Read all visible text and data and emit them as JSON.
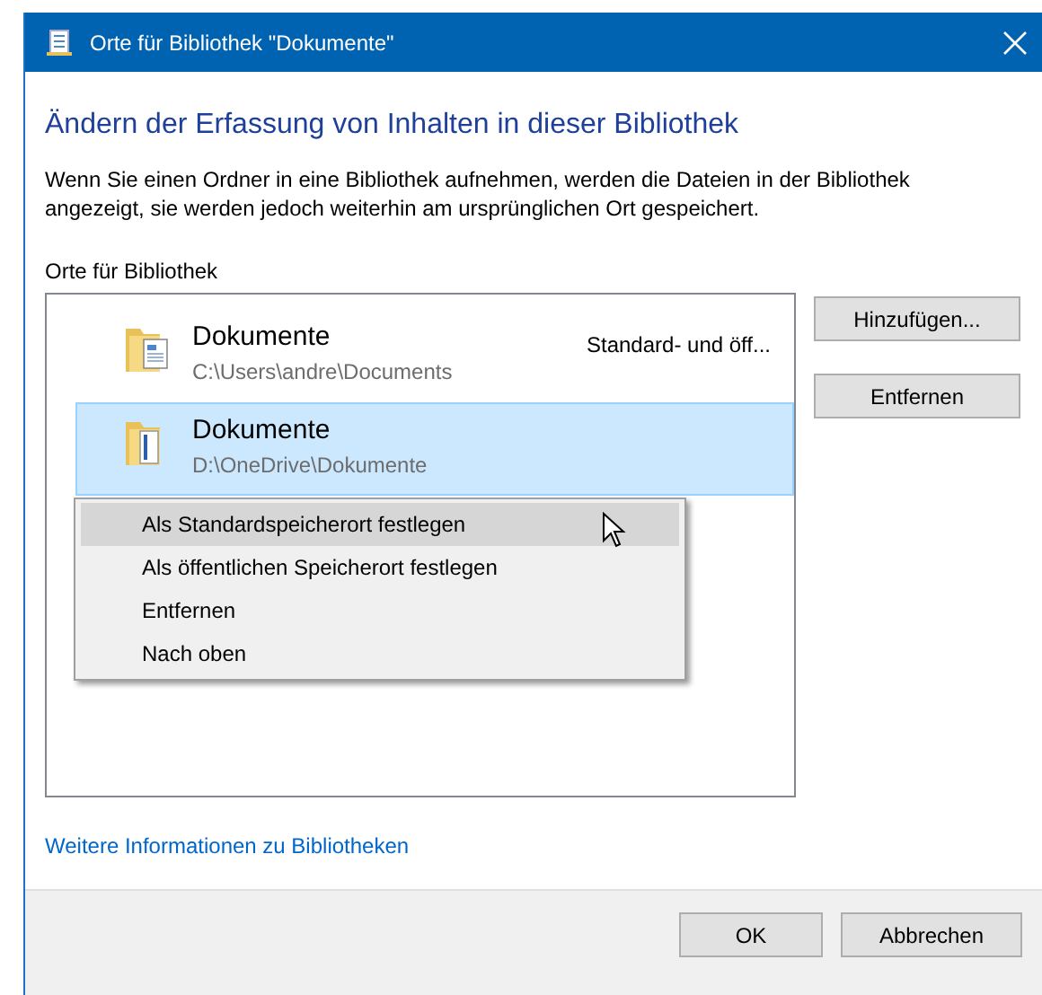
{
  "window": {
    "title": "Orte für Bibliothek \"Dokumente\""
  },
  "heading": "Ändern der Erfassung von Inhalten in dieser Bibliothek",
  "description": "Wenn Sie einen Ordner in eine Bibliothek aufnehmen, werden die Dateien in der Bibliothek angezeigt, sie werden jedoch weiterhin am ursprünglichen Ort gespeichert.",
  "locations_label": "Orte für Bibliothek",
  "locations": [
    {
      "name": "Dokumente",
      "path": "C:\\Users\\andre\\Documents",
      "status": "Standard- und öff...",
      "selected": false
    },
    {
      "name": "Dokumente",
      "path": "D:\\OneDrive\\Dokumente",
      "selected": true
    }
  ],
  "side_buttons": [
    "Hinzufügen...",
    "Entfernen"
  ],
  "context_menu": [
    {
      "label": "Als Standardspeicherort festlegen",
      "selected": true
    },
    {
      "label": "Als öffentlichen Speicherort festlegen",
      "selected": false
    },
    {
      "label": "Entfernen",
      "selected": false
    },
    {
      "label": "Nach oben",
      "selected": false
    }
  ],
  "link": "Weitere Informationen zu Bibliotheken",
  "buttons": [
    "OK",
    "Abbrechen"
  ]
}
